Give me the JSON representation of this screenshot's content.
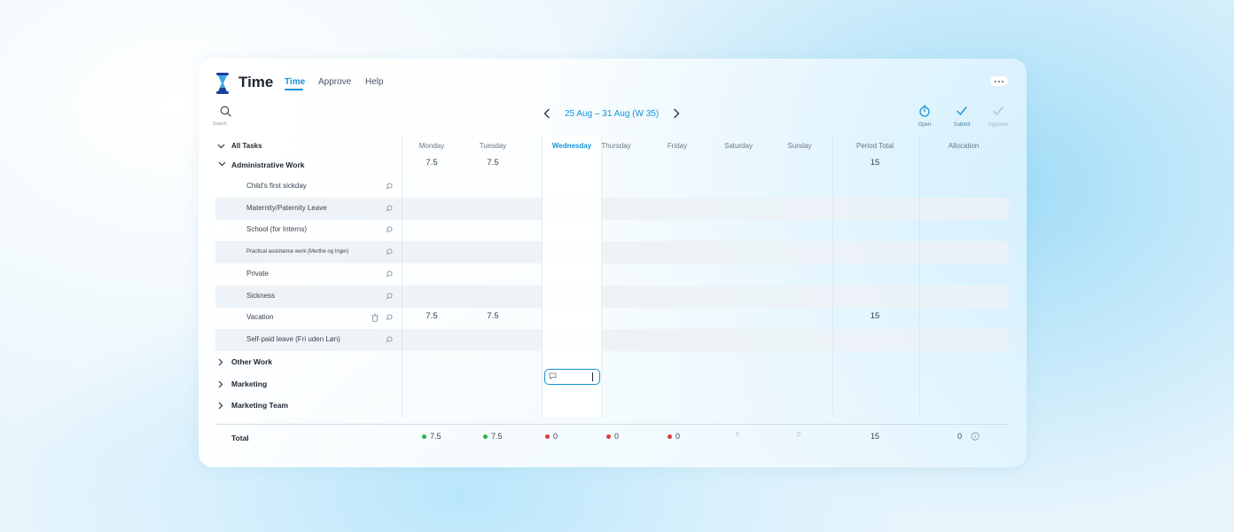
{
  "app": {
    "title": "Time",
    "nav": [
      {
        "label": "Time",
        "active": true
      },
      {
        "label": "Approve",
        "active": false
      },
      {
        "label": "Help",
        "active": false
      }
    ]
  },
  "toolbar": {
    "search_label": "Search",
    "week_range": "25 Aug – 31 Aug (W 35)",
    "actions": {
      "open": "Open",
      "submit": "Submit",
      "approve": "Approve"
    }
  },
  "colors": {
    "accent": "#1693d6",
    "ok": "#2bb14e",
    "missing": "#e23a3a"
  },
  "table": {
    "columns": {
      "tasks": "All Tasks",
      "monday": "Monday",
      "tuesday": "Tuesday",
      "wednesday": "Wednesday",
      "thursday": "Thursday",
      "friday": "Friday",
      "saturday": "Saturday",
      "sunday": "Sunday",
      "period_total": "Period Total",
      "allocation": "Allocation"
    },
    "groups": [
      {
        "label": "Administrative Work",
        "monday": "7.5",
        "tuesday": "7.5",
        "period_total": "15"
      },
      {
        "label": "Other Work"
      },
      {
        "label": "Marketing"
      },
      {
        "label": "Marketing Team"
      }
    ],
    "tasks": [
      {
        "label": "Child's first sickday"
      },
      {
        "label": "Maternity/Paternity Leave"
      },
      {
        "label": "School (for Interns)"
      },
      {
        "label": "Practical assistance work (Merthe og Inger)"
      },
      {
        "label": "Private"
      },
      {
        "label": "Sickness"
      },
      {
        "label": "Vacation",
        "monday": "7.5",
        "tuesday": "7.5",
        "period_total": "15"
      },
      {
        "label": "Self-paid leave (Fri uden Løn)"
      }
    ],
    "totals": {
      "label": "Total",
      "monday": "7.5",
      "tuesday": "7.5",
      "wednesday": "0",
      "thursday": "0",
      "friday": "0",
      "saturday": "0",
      "sunday": "0",
      "period_total": "15",
      "allocation": "0"
    }
  }
}
